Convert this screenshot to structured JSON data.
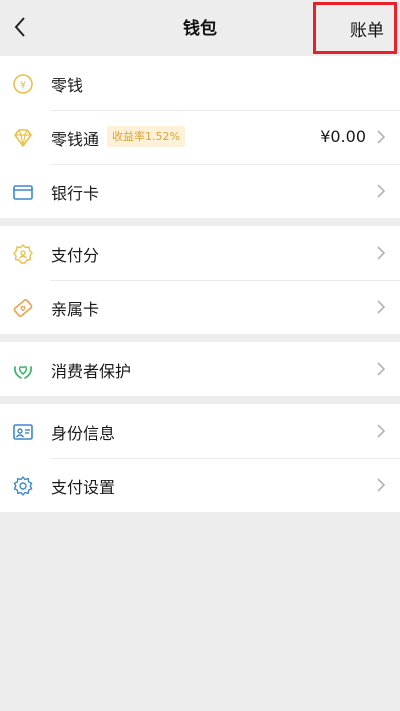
{
  "header": {
    "title": "钱包",
    "bill_label": "账单"
  },
  "colors": {
    "accent_green": "#07c160",
    "gold": "#e8c24a",
    "orange": "#f0a04b",
    "blue": "#3e87c8",
    "highlight_red": "#e8202a"
  },
  "groups": [
    {
      "items": [
        {
          "label": "零钱",
          "icon": "coin-yuan-icon"
        },
        {
          "label": "零钱通",
          "icon": "diamond-icon",
          "badge": "收益率1.52%",
          "value": "¥0.00"
        },
        {
          "label": "银行卡",
          "icon": "bank-card-icon"
        }
      ]
    },
    {
      "items": [
        {
          "label": "支付分",
          "icon": "credit-score-icon"
        },
        {
          "label": "亲属卡",
          "icon": "family-card-icon"
        }
      ]
    },
    {
      "items": [
        {
          "label": "消费者保护",
          "icon": "consumer-protection-icon"
        }
      ]
    },
    {
      "items": [
        {
          "label": "身份信息",
          "icon": "id-card-icon"
        },
        {
          "label": "支付设置",
          "icon": "gear-icon"
        }
      ]
    }
  ]
}
